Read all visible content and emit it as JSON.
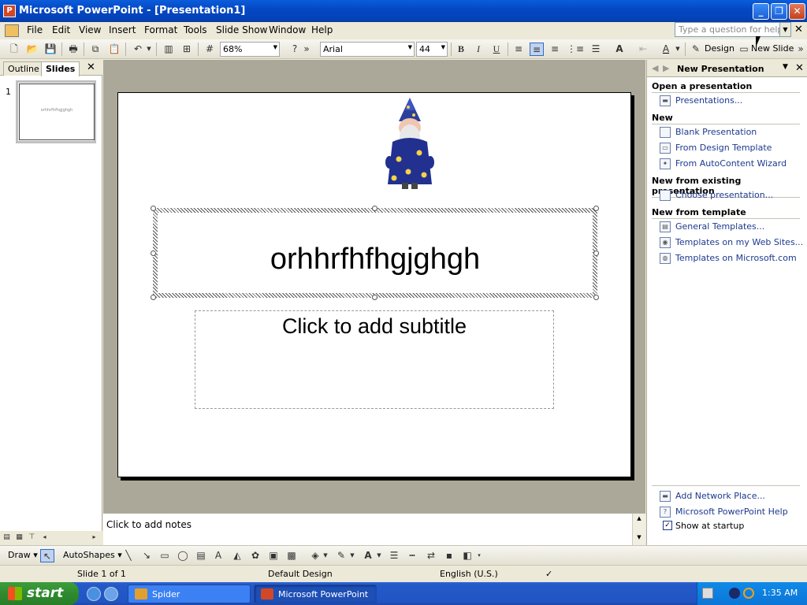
{
  "window": {
    "title": "Microsoft PowerPoint - [Presentation1]",
    "controls": [
      "_",
      "❐",
      "✕"
    ]
  },
  "menubar": {
    "items": [
      "File",
      "Edit",
      "View",
      "Insert",
      "Format",
      "Tools",
      "Slide Show",
      "Window",
      "Help"
    ],
    "help_placeholder": "Type a question for help"
  },
  "toolbar": {
    "zoom": "68%",
    "font": "Arial",
    "size": "44",
    "design_label": "Design",
    "new_slide_label": "New Slide",
    "bold": "B",
    "italic": "I",
    "underline": "U"
  },
  "left_pane": {
    "tabs": [
      "Outline",
      "Slides"
    ],
    "active_tab": "Slides",
    "slide_number": "1",
    "thumbnail_text": "orhhrfhfhgjghgh"
  },
  "slide": {
    "title": "orhhrfhfhgjghgh",
    "subtitle_placeholder": "Click to add subtitle"
  },
  "notes": {
    "placeholder": "Click to add notes"
  },
  "task_pane": {
    "title": "New Presentation",
    "sections": [
      {
        "heading": "Open a presentation",
        "links": [
          "Presentations..."
        ]
      },
      {
        "heading": "New",
        "links": [
          "Blank Presentation",
          "From Design Template",
          "From AutoContent Wizard"
        ]
      },
      {
        "heading": "New from existing presentation",
        "links": [
          "Choose presentation..."
        ]
      },
      {
        "heading": "New from template",
        "links": [
          "General Templates...",
          "Templates on my Web Sites...",
          "Templates on Microsoft.com"
        ]
      }
    ],
    "footer_links": [
      "Add Network Place...",
      "Microsoft PowerPoint Help"
    ],
    "show_at_startup": "Show at startup",
    "show_at_startup_checked": true
  },
  "drawing_toolbar": {
    "draw": "Draw",
    "autoshapes": "AutoShapes"
  },
  "statusbar": {
    "slide_info": "Slide 1 of 1",
    "design": "Default Design",
    "language": "English (U.S.)"
  },
  "taskbar": {
    "start_label": "start",
    "tasks": [
      "Spider",
      "Microsoft PowerPoint ..."
    ],
    "active_task": "Microsoft PowerPoint ...",
    "clock": "1:35 AM"
  },
  "colors": {
    "titlebar": "#0548c4",
    "taskbar": "#2155c4",
    "start": "#2f8a2f",
    "link": "#1c3a8e",
    "slide_area": "#aca899"
  }
}
